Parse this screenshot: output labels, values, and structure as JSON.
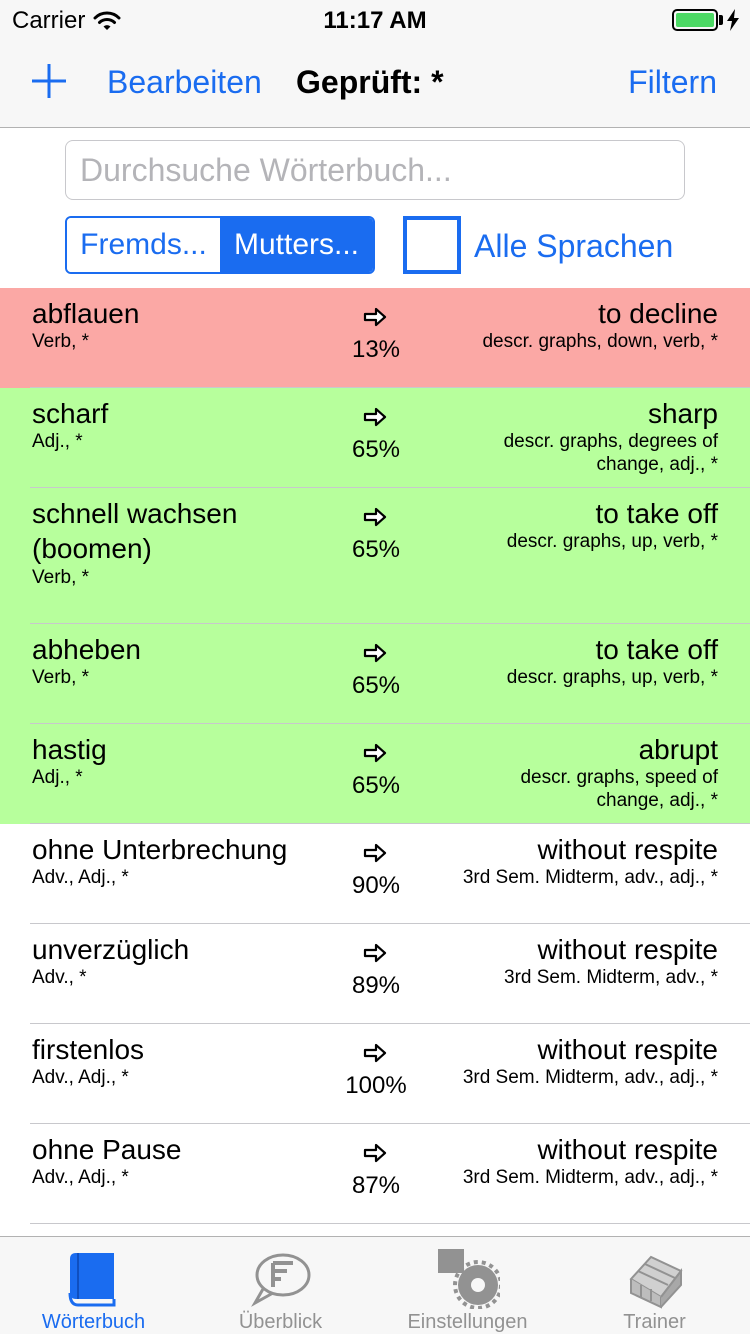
{
  "status": {
    "carrier": "Carrier",
    "time": "11:17 AM",
    "battery_color": "#4cd964"
  },
  "nav": {
    "add_icon": "plus-icon",
    "edit_label": "Bearbeiten",
    "title": "Geprüft: *",
    "filter_label": "Filtern"
  },
  "search": {
    "placeholder": "Durchsuche Wörterbuch...",
    "value": ""
  },
  "segments": [
    {
      "label": "Fremds...",
      "selected": false
    },
    {
      "label": "Mutters...",
      "selected": true
    }
  ],
  "all_languages": {
    "label": "Alle Sprachen",
    "checked": false
  },
  "colors": {
    "accent": "#1a6cf0",
    "row_red": "#fba8a5",
    "row_green": "#b7ff9c",
    "row_white": "#ffffff"
  },
  "entries": [
    {
      "term": "abflauen",
      "term_meta": "Verb, *",
      "percent": "13%",
      "translation": "to decline",
      "translation_meta": "descr. graphs, down, verb, *",
      "status": "red"
    },
    {
      "term": "scharf",
      "term_meta": "Adj., *",
      "percent": "65%",
      "translation": "sharp",
      "translation_meta": "descr. graphs, degrees of change, adj., *",
      "status": "green"
    },
    {
      "term": "schnell wachsen (boomen)",
      "term_meta": "Verb, *",
      "percent": "65%",
      "translation": "to take off",
      "translation_meta": "descr. graphs, up, verb, *",
      "status": "green"
    },
    {
      "term": "abheben",
      "term_meta": "Verb, *",
      "percent": "65%",
      "translation": "to take off",
      "translation_meta": "descr. graphs, up, verb, *",
      "status": "green"
    },
    {
      "term": "hastig",
      "term_meta": "Adj., *",
      "percent": "65%",
      "translation": "abrupt",
      "translation_meta": "descr. graphs, speed of change, adj., *",
      "status": "green"
    },
    {
      "term": "ohne Unterbrechung",
      "term_meta": "Adv., Adj., *",
      "percent": "90%",
      "translation": "without respite",
      "translation_meta": "3rd Sem. Midterm, adv., adj., *",
      "status": "white"
    },
    {
      "term": "unverzüglich",
      "term_meta": "Adv., *",
      "percent": "89%",
      "translation": "without respite",
      "translation_meta": "3rd Sem. Midterm, adv., *",
      "status": "white"
    },
    {
      "term": "firstenlos",
      "term_meta": "Adv., Adj., *",
      "percent": "100%",
      "translation": "without respite",
      "translation_meta": "3rd Sem. Midterm, adv., adj., *",
      "status": "white"
    },
    {
      "term": "ohne Pause",
      "term_meta": "Adv., Adj., *",
      "percent": "87%",
      "translation": "without respite",
      "translation_meta": "3rd Sem. Midterm, adv., adj., *",
      "status": "white"
    }
  ],
  "tabs": [
    {
      "label": "Wörterbuch",
      "icon": "book-icon",
      "active": true
    },
    {
      "label": "Überblick",
      "icon": "speech-bubble-icon",
      "active": false
    },
    {
      "label": "Einstellungen",
      "icon": "gears-icon",
      "active": false
    },
    {
      "label": "Trainer",
      "icon": "greenhouse-icon",
      "active": false
    }
  ]
}
